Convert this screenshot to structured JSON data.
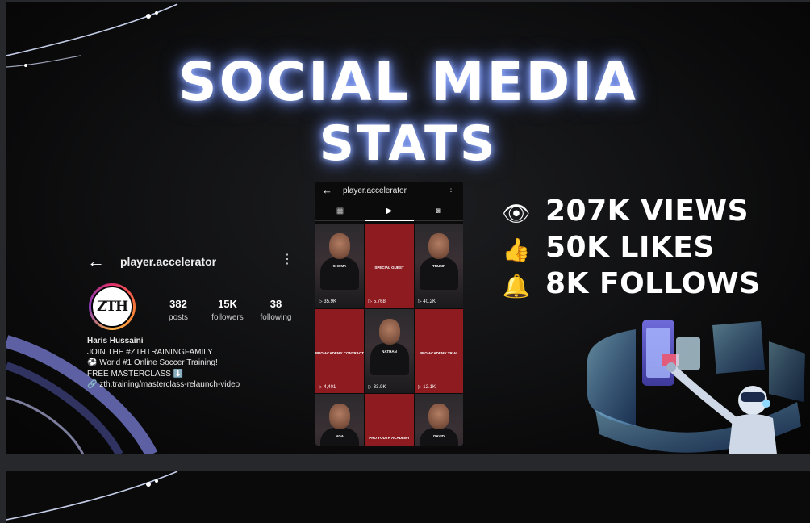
{
  "title": {
    "line1": "SOCIAL MEDIA",
    "line2": "STATS"
  },
  "profile": {
    "username": "player.accelerator",
    "back_glyph": "←",
    "menu_glyph": "⋮",
    "logo_text": "ZTH",
    "stats": [
      {
        "value": "382",
        "label": "posts"
      },
      {
        "value": "15K",
        "label": "followers"
      },
      {
        "value": "38",
        "label": "following"
      }
    ],
    "bio": {
      "name": "Haris Hussaini",
      "line1": "JOIN THE #ZTHTRAININGFAMILY",
      "line2": "⚽ World #1 Online Soccer Training!",
      "line3": "FREE MASTERCLASS ⬇️",
      "link": "zth.training/masterclass-relaunch-video"
    }
  },
  "phone": {
    "username": "player.accelerator",
    "back_glyph": "←",
    "menu_glyph": "⋮",
    "tabs": [
      {
        "icon": "grid-icon",
        "glyph": "▦"
      },
      {
        "icon": "reels-icon",
        "glyph": "▶"
      },
      {
        "icon": "tagged-icon",
        "glyph": "◙"
      }
    ],
    "cells": [
      {
        "kind": "person",
        "caption": "SHOMA",
        "views": "▷ 35.9K"
      },
      {
        "kind": "red",
        "caption": "SPECIAL GUEST",
        "views": "▷ 5,768"
      },
      {
        "kind": "person",
        "caption": "TRUMP",
        "views": "▷ 40.2K"
      },
      {
        "kind": "red",
        "caption": "PRO ACADEMY CONTRACT",
        "views": "▷ 4,401"
      },
      {
        "kind": "person",
        "caption": "NATHAN",
        "views": "▷ 33.9K"
      },
      {
        "kind": "red",
        "caption": "PRO ACADEMY TRIAL",
        "views": "▷ 12.1K"
      },
      {
        "kind": "person",
        "caption": "NOA",
        "views": ""
      },
      {
        "kind": "red",
        "caption": "PRO YOUTH ACADEMY",
        "views": ""
      },
      {
        "kind": "person",
        "caption": "DAVID",
        "views": ""
      }
    ]
  },
  "stats": [
    {
      "icon": "eye-icon",
      "glyph": "👁",
      "text": "207K VIEWS"
    },
    {
      "icon": "thumbs-up-icon",
      "glyph": "👍",
      "text": "50K LIKES"
    },
    {
      "icon": "bell-icon",
      "glyph": "🔔",
      "text": "8K FOLLOWS"
    }
  ],
  "colors": {
    "accent_glow": "#6c8dff",
    "reel_red": "#8e1b1f",
    "holo_cyan": "#8fd8ff"
  }
}
